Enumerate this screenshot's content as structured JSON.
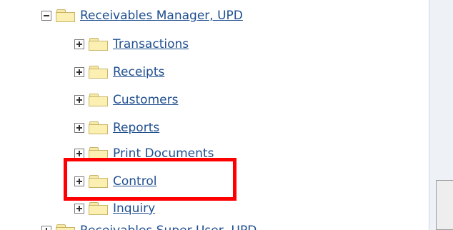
{
  "tree": {
    "root": {
      "label": "Receivables Manager, UPD",
      "state": "expanded"
    },
    "children": [
      {
        "label": "Transactions",
        "state": "collapsed"
      },
      {
        "label": "Receipts",
        "state": "collapsed"
      },
      {
        "label": "Customers",
        "state": "collapsed"
      },
      {
        "label": "Reports",
        "state": "collapsed"
      },
      {
        "label": "Print Documents",
        "state": "collapsed"
      },
      {
        "label": "Control",
        "state": "collapsed"
      },
      {
        "label": "Inquiry",
        "state": "collapsed"
      }
    ],
    "next_root": {
      "label": "Receivables Super User, UPD",
      "state": "collapsed"
    }
  },
  "highlight": {
    "target": "Control",
    "color": "#ff0000"
  },
  "colors": {
    "link": "#1f4f8f",
    "folder": "#fbefb2",
    "panel": "#eef2f7"
  }
}
